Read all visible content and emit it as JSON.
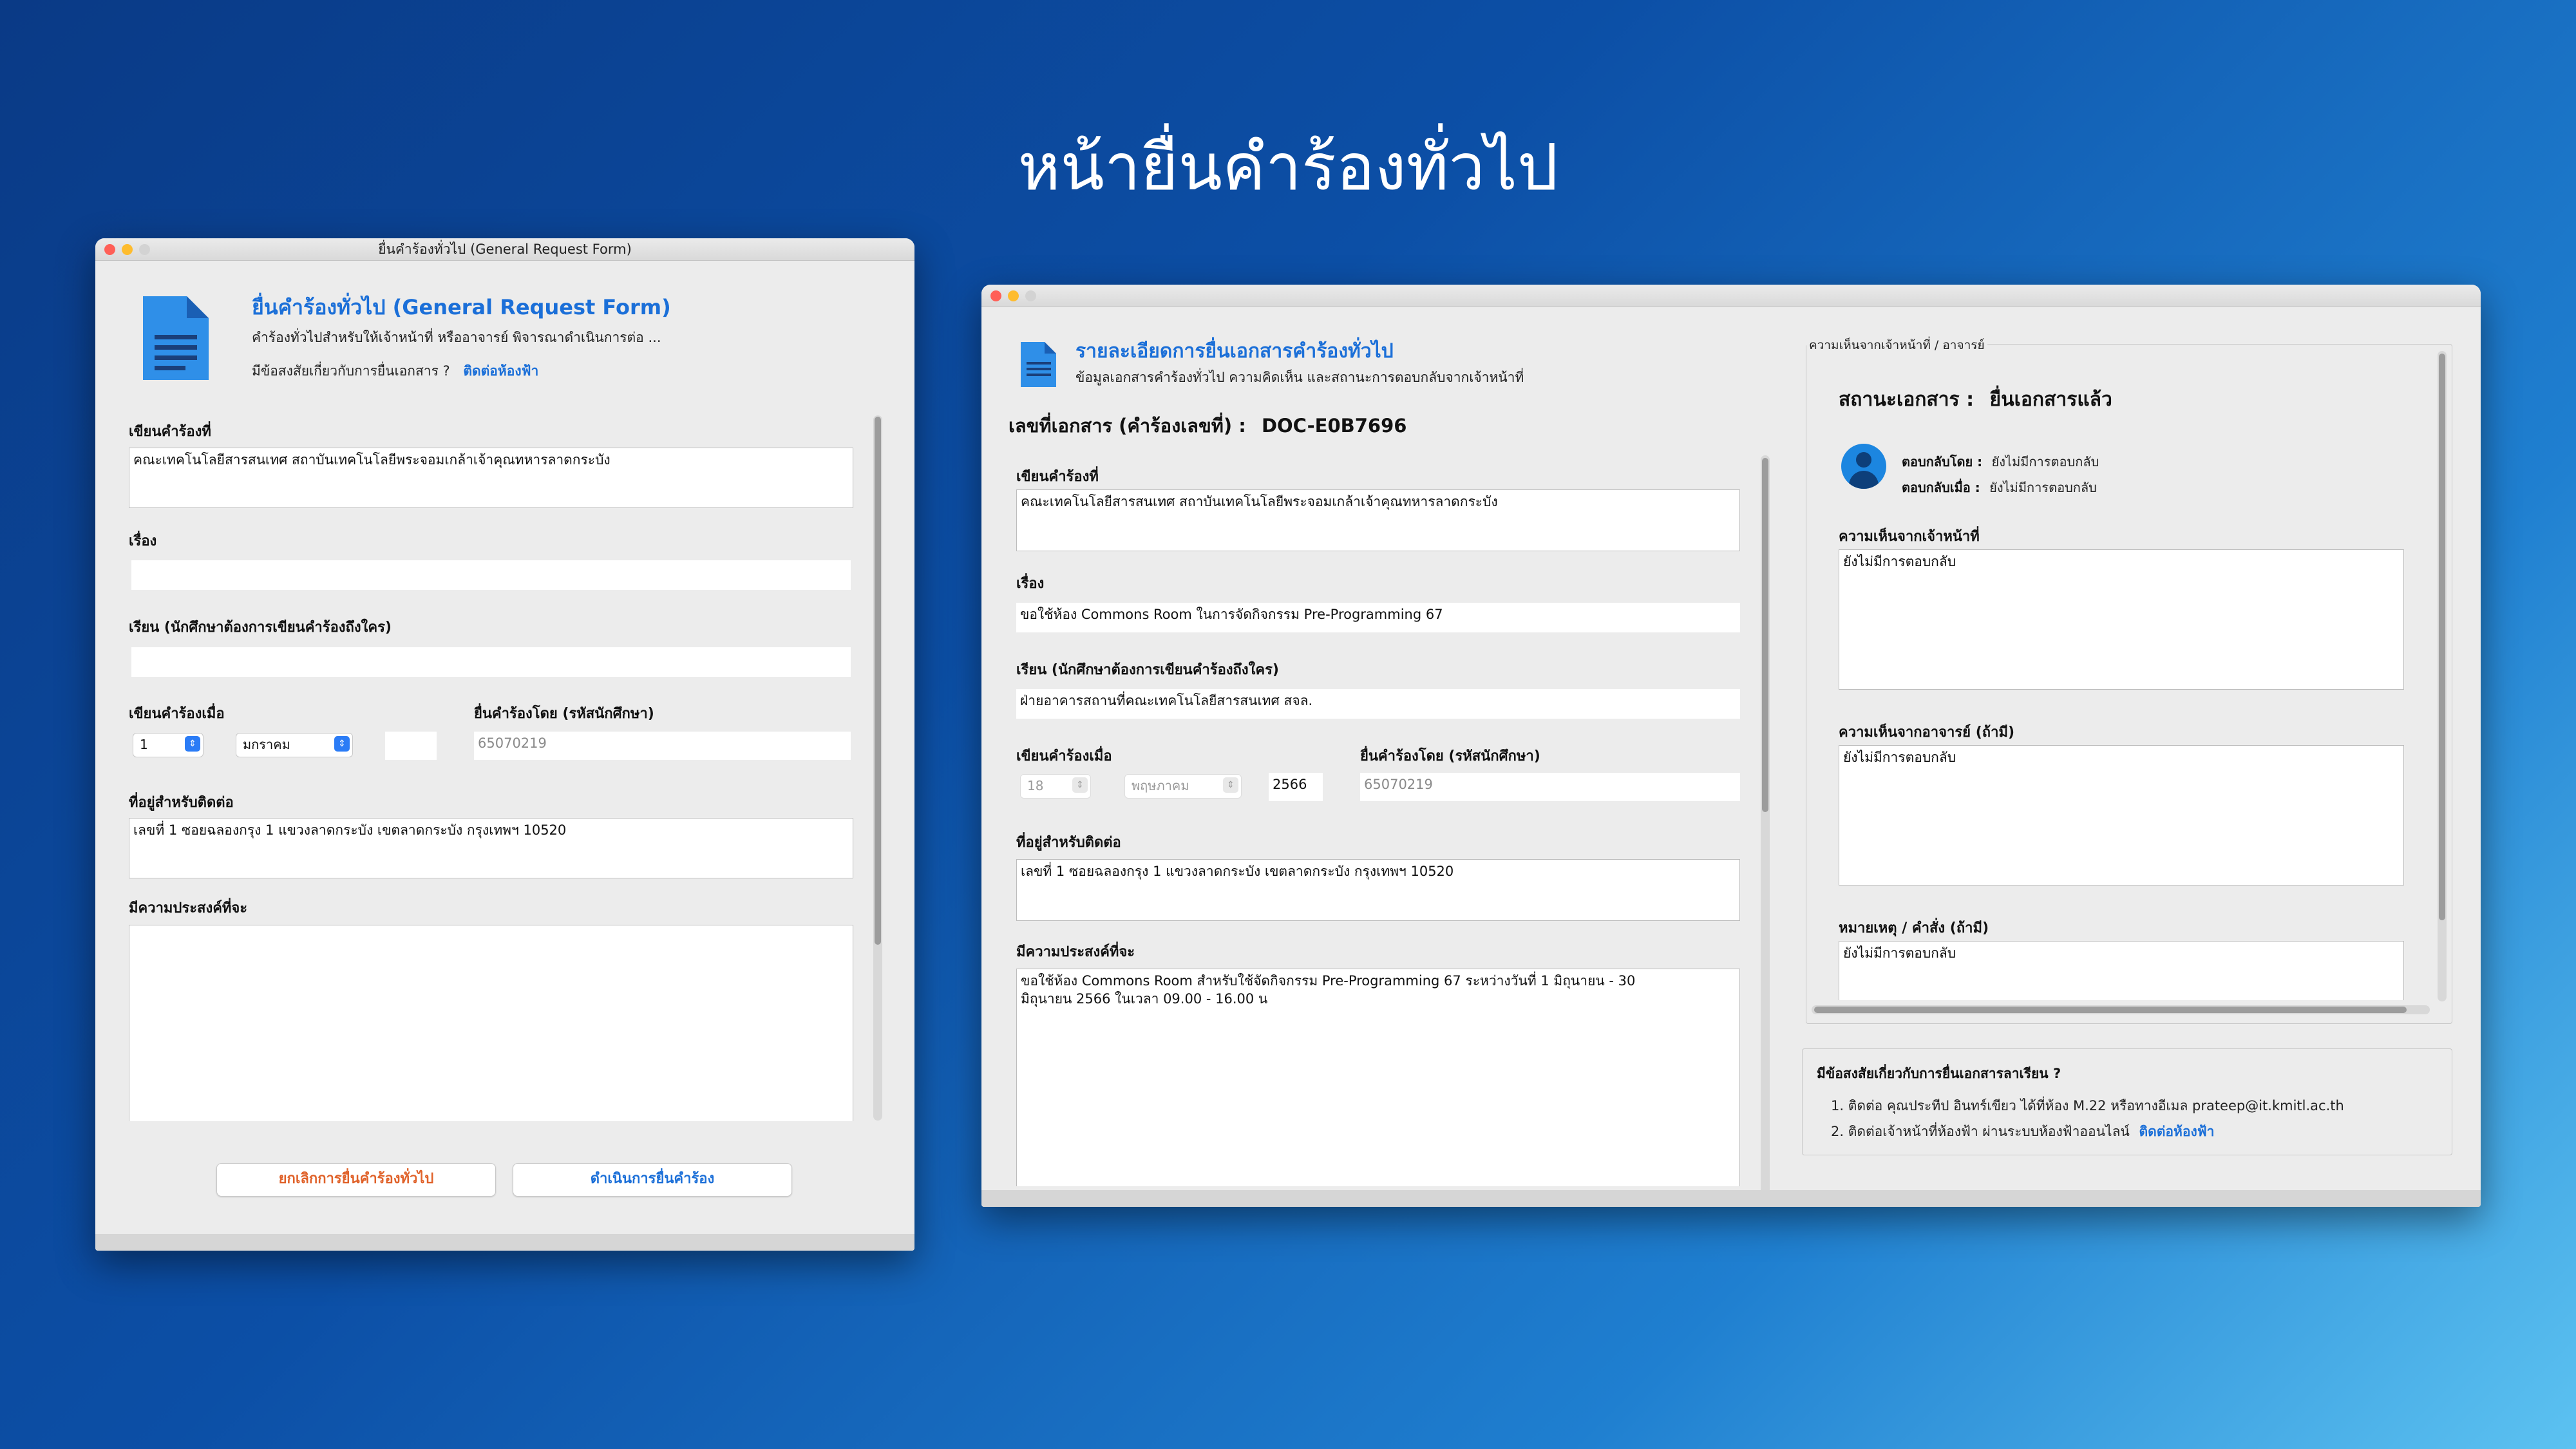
{
  "page": {
    "title": "หน้ายื่นคำร้องทั่วไป"
  },
  "left_window": {
    "title": "ยื่นคำร้องทั่วไป (General Request Form)",
    "header_title": "ยื่นคำร้องทั่วไป (General Request Form)",
    "header_desc": "คำร้องทั่วไปสำหรับให้เจ้าหน้าที่ หรืออาจารย์ พิจารณาดำเนินการต่อ ...",
    "help_text": "มีข้อสงสัยเกี่ยวกับการยื่นเอกสาร ?",
    "help_link": "ติดต่อห้องฟ้า",
    "written_at_label": "เขียนคำร้องที่",
    "written_at_value": "คณะเทคโนโลยีสารสนเทศ สถาบันเทคโนโลยีพระจอมเกล้าเจ้าคุณทหารลาดกระบัง",
    "subject_label": "เรื่อง",
    "subject_value": "",
    "to_label": "เรียน (นักศึกษาต้องการเขียนคำร้องถึงใคร)",
    "to_value": "",
    "date_label": "เขียนคำร้องเมื่อ",
    "day_value": "1",
    "month_value": "มกราคม",
    "year_value": "",
    "submitter_label": "ยื่นคำร้องโดย (รหัสนักศึกษา)",
    "submitter_value": "65070219",
    "address_label": "ที่อยู่สำหรับติดต่อ",
    "address_value": "เลขที่ 1 ซอยฉลองกรุง 1 แขวงลาดกระบัง เขตลาดกระบัง กรุงเทพฯ 10520",
    "purpose_label": "มีความประสงค์ที่จะ",
    "purpose_value": "",
    "cancel_button": "ยกเลิกการยื่นคำร้องทั่วไป",
    "submit_button": "ดำเนินการยื่นคำร้อง"
  },
  "right_window": {
    "header_title": "รายละเอียดการยื่นเอกสารคำร้องทั่วไป",
    "header_desc": "ข้อมูลเอกสารคำร้องทั่วไป ความคิดเห็น และสถานะการตอบกลับจากเจ้าหน้าที่",
    "doc_no_label": "เลขที่เอกสาร (คำร้องเลขที่) :",
    "doc_no_value": "DOC-E0B7696",
    "written_at_label": "เขียนคำร้องที่",
    "written_at_value": "คณะเทคโนโลยีสารสนเทศ สถาบันเทคโนโลยีพระจอมเกล้าเจ้าคุณทหารลาดกระบัง",
    "subject_label": "เรื่อง",
    "subject_value": "ขอใช้ห้อง Commons Room ในการจัดกิจกรรม Pre-Programming 67",
    "to_label": "เรียน (นักศึกษาต้องการเขียนคำร้องถึงใคร)",
    "to_value": "ฝ่ายอาคารสถานที่คณะเทคโนโลยีสารสนเทศ สจล.",
    "date_label": "เขียนคำร้องเมื่อ",
    "day_value": "18",
    "month_value": "พฤษภาคม",
    "year_value": "2566",
    "submitter_label": "ยื่นคำร้องโดย (รหัสนักศึกษา)",
    "submitter_value": "65070219",
    "address_label": "ที่อยู่สำหรับติดต่อ",
    "address_value": "เลขที่ 1 ซอยฉลองกรุง 1 แขวงลาดกระบัง เขตลาดกระบัง กรุงเทพฯ 10520",
    "purpose_label": "มีความประสงค์ที่จะ",
    "purpose_line1": "ขอใช้ห้อง Commons Room สำหรับใช้จัดกิจกรรม Pre-Programming 67 ระหว่างวันที่ 1 มิถุนายน - 30",
    "purpose_line2": "มิถุนายน 2566 ในเวลา 09.00 - 16.00 น",
    "comments_group_title": "ความเห็นจากเจ้าหน้าที่ / อาจารย์",
    "status_label": "สถานะเอกสาร :",
    "status_value": "ยื่นเอกสารแล้ว",
    "reply_by_label": "ตอบกลับโดย :",
    "reply_by_value": "ยังไม่มีการตอบกลับ",
    "reply_at_label": "ตอบกลับเมื่อ :",
    "reply_at_value": "ยังไม่มีการตอบกลับ",
    "staff_comment_label": "ความเห็นจากเจ้าหน้าที่",
    "staff_comment_value": "ยังไม่มีการตอบกลับ",
    "advisor_comment_label": "ความเห็นจากอาจารย์ (ถ้ามี)",
    "advisor_comment_value": "ยังไม่มีการตอบกลับ",
    "note_label": "หมายเหตุ / คำสั่ง (ถ้ามี)",
    "note_value": "ยังไม่มีการตอบกลับ",
    "help_title": "มีข้อสงสัยเกี่ยวกับการยื่นเอกสารลาเรียน ?",
    "help_line1": "1. ติดต่อ คุณประทีป อินทร์เขียว ได้ที่ห้อง M.22 หรือทางอีเมล prateep@it.kmitl.ac.th",
    "help_line2": "2. ติดต่อเจ้าหน้าที่ห้องฟ้า ผ่านระบบห้องฟ้าออนไลน์",
    "help_link": "ติดต่อห้องฟ้า"
  },
  "colors": {
    "accent": "#1b6fd8",
    "cancel_text": "#e0622a",
    "background_start": "#0a3a86",
    "background_end": "#5cc2f1"
  },
  "icons": [
    "document-icon",
    "avatar-icon"
  ]
}
